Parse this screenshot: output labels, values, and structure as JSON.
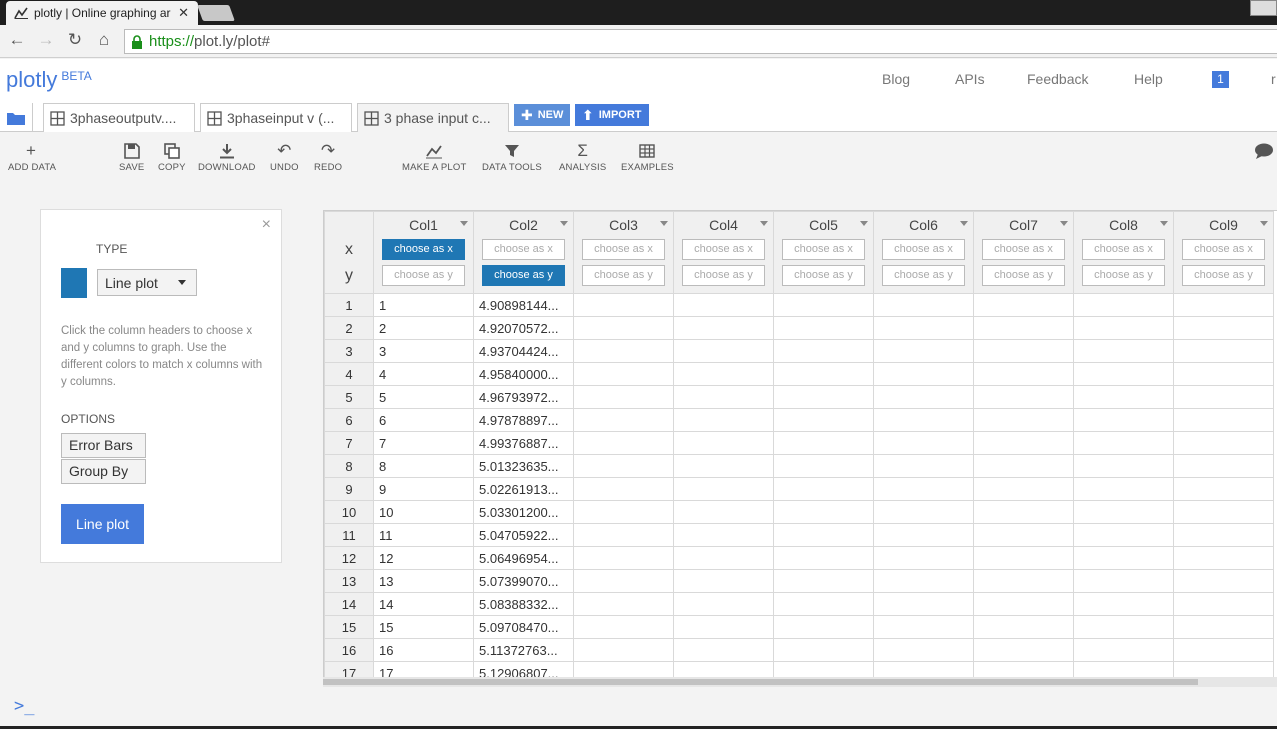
{
  "browser": {
    "tab_title": "plotly | Online graphing ar",
    "url_scheme": "https://",
    "url_rest": "plot.ly/plot#"
  },
  "header": {
    "logo": "plotly",
    "logo_badge": "BETA",
    "nav": [
      "Blog",
      "APIs",
      "Feedback",
      "Help"
    ],
    "notifications": "1",
    "user_initial": "r"
  },
  "file_tabs": [
    "3phaseoutputv....",
    "3phaseinput v (...",
    "3 phase input c..."
  ],
  "buttons": {
    "new": "NEW",
    "import": "IMPORT"
  },
  "toolbar": {
    "add_data": "ADD DATA",
    "save": "SAVE",
    "copy": "COPY",
    "download": "DOWNLOAD",
    "undo": "UNDO",
    "redo": "REDO",
    "make_plot": "MAKE A PLOT",
    "data_tools": "DATA TOOLS",
    "analysis": "ANALYSIS",
    "examples": "EXAMPLES"
  },
  "panel": {
    "close": "×",
    "type_label": "TYPE",
    "type_value": "Line plot",
    "trace_color": "#1f77b4",
    "help": "Click the column headers to choose x and y columns to graph. Use the different colors to match x columns with y columns.",
    "options_label": "OPTIONS",
    "error_bars": "Error Bars",
    "group_by": "Group By",
    "submit": "Line plot"
  },
  "grid": {
    "x_label": "x",
    "y_label": "y",
    "choose_x": "choose as x",
    "choose_y": "choose as y",
    "columns": [
      "Col1",
      "Col2",
      "Col3",
      "Col4",
      "Col5",
      "Col6",
      "Col7",
      "Col8",
      "Col9"
    ],
    "selected_x": "Col1",
    "selected_y": "Col2",
    "rows": [
      [
        "1",
        "1",
        "4.90898144..."
      ],
      [
        "2",
        "2",
        "4.92070572..."
      ],
      [
        "3",
        "3",
        "4.93704424..."
      ],
      [
        "4",
        "4",
        "4.95840000..."
      ],
      [
        "5",
        "5",
        "4.96793972..."
      ],
      [
        "6",
        "6",
        "4.97878897..."
      ],
      [
        "7",
        "7",
        "4.99376887..."
      ],
      [
        "8",
        "8",
        "5.01323635..."
      ],
      [
        "9",
        "9",
        "5.02261913..."
      ],
      [
        "10",
        "10",
        "5.03301200..."
      ],
      [
        "11",
        "11",
        "5.04705922..."
      ],
      [
        "12",
        "12",
        "5.06496954..."
      ],
      [
        "13",
        "13",
        "5.07399070..."
      ],
      [
        "14",
        "14",
        "5.08388332..."
      ],
      [
        "15",
        "15",
        "5.09708470..."
      ],
      [
        "16",
        "16",
        "5.11372763..."
      ],
      [
        "17",
        "17",
        "5.12906807..."
      ]
    ]
  },
  "console_prompt": ">_"
}
